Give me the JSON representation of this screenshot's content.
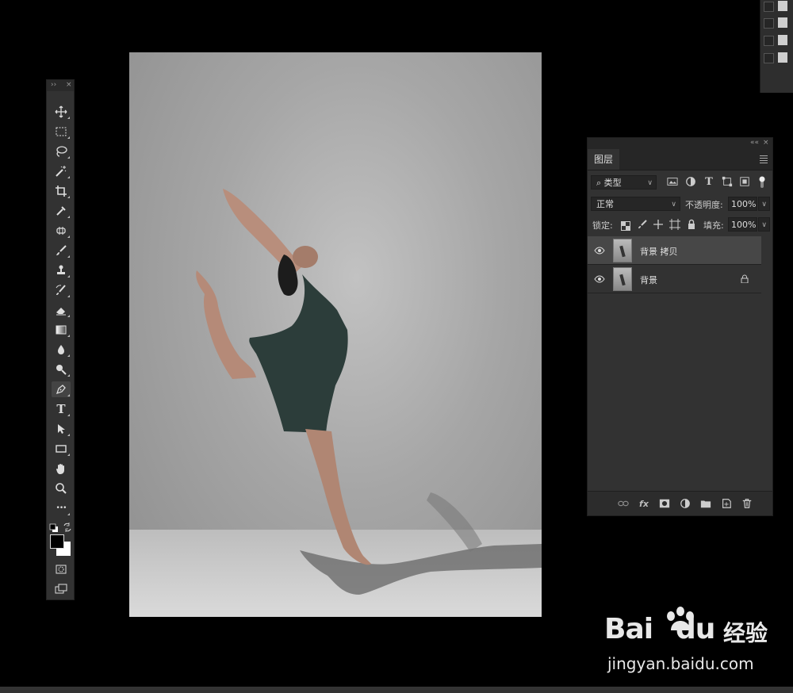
{
  "toolbox": {
    "header": {
      "collapse": "››",
      "close": "×"
    },
    "tools": [
      {
        "icon": "move-icon"
      },
      {
        "icon": "rectangular-marquee-icon"
      },
      {
        "icon": "lasso-icon"
      },
      {
        "icon": "magic-wand-icon"
      },
      {
        "icon": "crop-icon"
      },
      {
        "icon": "eyedropper-icon"
      },
      {
        "icon": "spot-healing-icon"
      },
      {
        "icon": "brush-icon"
      },
      {
        "icon": "clone-stamp-icon"
      },
      {
        "icon": "history-brush-icon"
      },
      {
        "icon": "eraser-icon"
      },
      {
        "icon": "gradient-icon"
      },
      {
        "icon": "blur-icon"
      },
      {
        "icon": "dodge-icon"
      },
      {
        "icon": "pen-icon"
      },
      {
        "icon": "type-icon",
        "glyph": "T"
      },
      {
        "icon": "path-selection-icon"
      },
      {
        "icon": "rectangle-shape-icon"
      },
      {
        "icon": "hand-icon"
      },
      {
        "icon": "zoom-icon"
      },
      {
        "icon": "more-tools-icon",
        "glyph": "•••"
      }
    ],
    "colors": {
      "foreground": "#000000",
      "background": "#ffffff"
    }
  },
  "layers_panel": {
    "header": {
      "collapse": "««",
      "close": "×"
    },
    "tab_label": "图层",
    "filter": {
      "kind_label": "类型"
    },
    "blend_mode": "正常",
    "opacity_label": "不透明度:",
    "opacity_value": "100%",
    "lock_label": "锁定:",
    "fill_label": "填充:",
    "fill_value": "100%",
    "layers": [
      {
        "name": "背景 拷贝",
        "visible": true,
        "selected": true,
        "locked": false
      },
      {
        "name": "背景",
        "visible": true,
        "selected": false,
        "locked": true
      }
    ],
    "footer_fx": "fx"
  },
  "watermark": {
    "brand": "Bai",
    "brand_du": "du",
    "brand_cn": "经验",
    "url": "jingyan.baidu.com"
  }
}
